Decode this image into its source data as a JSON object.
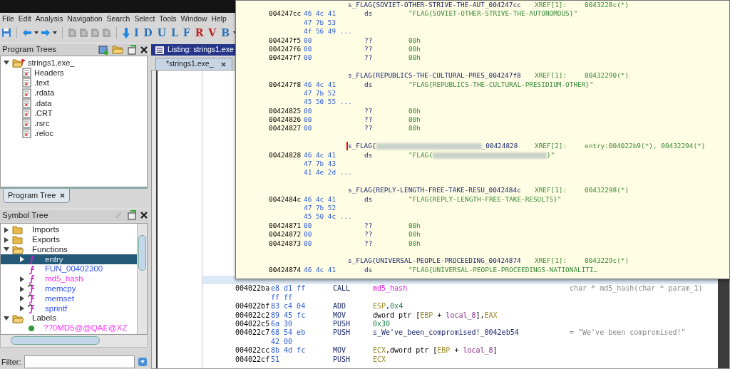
{
  "menu": [
    "File",
    "Edit",
    "Analysis",
    "Navigation",
    "Search",
    "Select",
    "Tools",
    "Window",
    "Help"
  ],
  "toolbar": {
    "letters": [
      {
        "text": "I",
        "crossed": false
      },
      {
        "text": "D",
        "crossed": false
      },
      {
        "text": "U",
        "crossed": false
      },
      {
        "text": "L",
        "crossed": false
      },
      {
        "text": "F",
        "crossed": false
      },
      {
        "text": "R",
        "crossed": true
      },
      {
        "text": "V",
        "crossed": true
      },
      {
        "text": "B",
        "crossed": false
      }
    ]
  },
  "program_trees": {
    "title": "Program Trees",
    "root": {
      "label": "strings1.exe_",
      "expanded": true,
      "children": [
        {
          "label": "Headers"
        },
        {
          "label": ".text"
        },
        {
          "label": ".rdata"
        },
        {
          "label": ".data"
        },
        {
          "label": ".CRT"
        },
        {
          "label": ".rsrc"
        },
        {
          "label": ".reloc"
        }
      ]
    },
    "tab": "Program Tree"
  },
  "symbol_tree": {
    "title": "Symbol Tree",
    "items": [
      {
        "label": "Imports",
        "kind": "folder",
        "expanded": false,
        "selected": false
      },
      {
        "label": "Exports",
        "kind": "folder",
        "expanded": false,
        "selected": false
      },
      {
        "label": "Functions",
        "kind": "folder",
        "expanded": true,
        "selected": false,
        "children": [
          {
            "label": "entry",
            "kind": "function",
            "expanded": false,
            "selected": true
          },
          {
            "label": "FUN_00402300",
            "kind": "function",
            "selected": false,
            "color": "#3050ff"
          },
          {
            "label": "md5_hash",
            "kind": "function",
            "expanded": false,
            "selected": false,
            "color": "#ff33ff"
          },
          {
            "label": "memcpy",
            "kind": "thunk",
            "expanded": false,
            "selected": false,
            "color": "#3050ff"
          },
          {
            "label": "memset",
            "kind": "thunk",
            "expanded": false,
            "selected": false,
            "color": "#3050ff"
          },
          {
            "label": "sprintf",
            "kind": "thunk",
            "expanded": false,
            "selected": false,
            "color": "#3050ff"
          }
        ]
      },
      {
        "label": "Labels",
        "kind": "folder",
        "expanded": true,
        "selected": false,
        "children": [
          {
            "label": "??0MD5@@QAE@XZ",
            "kind": "label",
            "selected": false,
            "color": "#ff33ff"
          }
        ]
      }
    ],
    "filter_label": "Filter:"
  },
  "listing": {
    "title": "Listing:  strings1.exe",
    "tab": "*strings1.exe_",
    "rows": [
      {
        "selected": true
      },
      {
        "address": "004022ba",
        "bytes": "e8 d1 ff",
        "mnemonic": "CALL",
        "operand": [
          {
            "text": "md5_hash",
            "kind": "function"
          }
        ],
        "comment": "char * md5_hash(char * param_1)",
        "selected": false
      },
      {
        "bytes": "ff ff",
        "selected": false
      },
      {
        "address": "004022bf",
        "bytes": "83 c4 04",
        "mnemonic": "ADD",
        "operand": [
          {
            "text": "ESP",
            "kind": "register"
          },
          {
            "text": ",",
            "kind": "plain"
          },
          {
            "text": "0x4",
            "kind": "scalar"
          }
        ],
        "selected": false
      },
      {
        "address": "004022c2",
        "bytes": "89 45 fc",
        "mnemonic": "MOV",
        "operand": [
          {
            "text": "dword ptr [",
            "kind": "plain"
          },
          {
            "text": "EBP",
            "kind": "register"
          },
          {
            "text": " + ",
            "kind": "plain"
          },
          {
            "text": "local_8",
            "kind": "local"
          },
          {
            "text": "],",
            "kind": "plain"
          },
          {
            "text": "EAX",
            "kind": "register"
          }
        ],
        "selected": false
      },
      {
        "address": "004022c5",
        "bytes": "6a 30",
        "mnemonic": "PUSH",
        "operand": [
          {
            "text": "0x30",
            "kind": "scalar"
          }
        ],
        "selected": false
      },
      {
        "address": "004022c7",
        "bytes": "68 54 eb",
        "mnemonic": "PUSH",
        "operand": [
          {
            "text": "s_We've_been_compromised!_0042eb54",
            "kind": "label"
          }
        ],
        "comment": "= \"We've been compromised!\"",
        "selected": false
      },
      {
        "bytes": "42 00",
        "selected": false
      },
      {
        "address": "004022cc",
        "bytes": "8b 4d fc",
        "mnemonic": "MOV",
        "operand": [
          {
            "text": "ECX",
            "kind": "register"
          },
          {
            "text": ",dword ptr [",
            "kind": "plain"
          },
          {
            "text": "EBP",
            "kind": "register"
          },
          {
            "text": " + ",
            "kind": "plain"
          },
          {
            "text": "local_8",
            "kind": "local"
          },
          {
            "text": "]",
            "kind": "plain"
          }
        ],
        "selected": false
      },
      {
        "address": "004022cf",
        "bytes": "51",
        "mnemonic": "PUSH",
        "operand": [
          {
            "text": "ECX",
            "kind": "register"
          }
        ],
        "selected": false
      }
    ]
  },
  "popup": {
    "rows": [
      {
        "kind": "label",
        "label": "s_FLAG{SOVIET-OTHER-STRIVE-THE-AUT_004247cc",
        "xref": "XREF[1]:",
        "refs": "0043228c(*)"
      },
      {
        "kind": "data",
        "address": "004247cc",
        "bytes": "46 4c 41",
        "mnemonic": "ds",
        "operand": "\"FLAG{SOVIET-OTHER-STRIVE-THE-AUTONOMOUS}\""
      },
      {
        "kind": "bytes",
        "bytes": "47 7b 53"
      },
      {
        "kind": "bytes",
        "bytes": "4f 56 49 ..."
      },
      {
        "kind": "data",
        "address": "004247f5",
        "bytes": "00",
        "mnemonic": "??",
        "operand": "00h"
      },
      {
        "kind": "data",
        "address": "004247f6",
        "bytes": "00",
        "mnemonic": "??",
        "operand": "00h"
      },
      {
        "kind": "data",
        "address": "004247f7",
        "bytes": "00",
        "mnemonic": "??",
        "operand": "00h"
      },
      {
        "kind": "blank"
      },
      {
        "kind": "label",
        "label": "s_FLAG{REPUBLICS-THE-CULTURAL-PRES_004247f8",
        "xref": "XREF[1]:",
        "refs": "00432290(*)"
      },
      {
        "kind": "data",
        "address": "004247f8",
        "bytes": "46 4c 41",
        "mnemonic": "ds",
        "operand": "\"FLAG{REPUBLICS-THE-CULTURAL-PRESIDIUM-OTHER}\""
      },
      {
        "kind": "bytes",
        "bytes": "47 7b 52"
      },
      {
        "kind": "bytes",
        "bytes": "45 50 55 ..."
      },
      {
        "kind": "data",
        "address": "00424825",
        "bytes": "00",
        "mnemonic": "??",
        "operand": "00h"
      },
      {
        "kind": "data",
        "address": "00424826",
        "bytes": "00",
        "mnemonic": "??",
        "operand": "00h"
      },
      {
        "kind": "data",
        "address": "00424827",
        "bytes": "00",
        "mnemonic": "??",
        "operand": "00h"
      },
      {
        "kind": "blank"
      },
      {
        "kind": "label",
        "label": "s_FLAG{",
        "label_tail": "_00424828",
        "redacted": true,
        "cursor": true,
        "xref": "XREF[2]:",
        "refs": "entry:004022b9(*), 00432294(*)"
      },
      {
        "kind": "data",
        "address": "00424828",
        "bytes": "46 4c 41",
        "mnemonic": "ds",
        "operand": "\"FLAG{",
        "operand_tail": "}\"",
        "redacted": true
      },
      {
        "kind": "bytes",
        "bytes": "47 7b 43"
      },
      {
        "kind": "bytes",
        "bytes": "41 4e 2d ..."
      },
      {
        "kind": "blank"
      },
      {
        "kind": "label",
        "label": "s_FLAG{REPLY-LENGTH-FREE-TAKE-RESU_0042484c",
        "xref": "XREF[1]:",
        "refs": "00432298(*)"
      },
      {
        "kind": "data",
        "address": "0042484c",
        "bytes": "46 4c 41",
        "mnemonic": "ds",
        "operand": "\"FLAG{REPLY-LENGTH-FREE-TAKE-RESULTS}\""
      },
      {
        "kind": "bytes",
        "bytes": "47 7b 52"
      },
      {
        "kind": "bytes",
        "bytes": "45 50 4c ..."
      },
      {
        "kind": "data",
        "address": "00424871",
        "bytes": "00",
        "mnemonic": "??",
        "operand": "00h"
      },
      {
        "kind": "data",
        "address": "00424872",
        "bytes": "00",
        "mnemonic": "??",
        "operand": "00h"
      },
      {
        "kind": "data",
        "address": "00424873",
        "bytes": "00",
        "mnemonic": "??",
        "operand": "00h"
      },
      {
        "kind": "blank"
      },
      {
        "kind": "label",
        "label": "s_FLAG{UNIVERSAL-PEOPLE-PROCEEDING_00424874",
        "xref": "XREF[1]:",
        "refs": "0043229c(*)"
      },
      {
        "kind": "data",
        "address": "00424874",
        "bytes": "46 4c 41",
        "mnemonic": "ds",
        "operand": "\"FLAG{UNIVERSAL-PEOPLE-PROCEEDINGS-NATIONALITI…"
      }
    ]
  }
}
